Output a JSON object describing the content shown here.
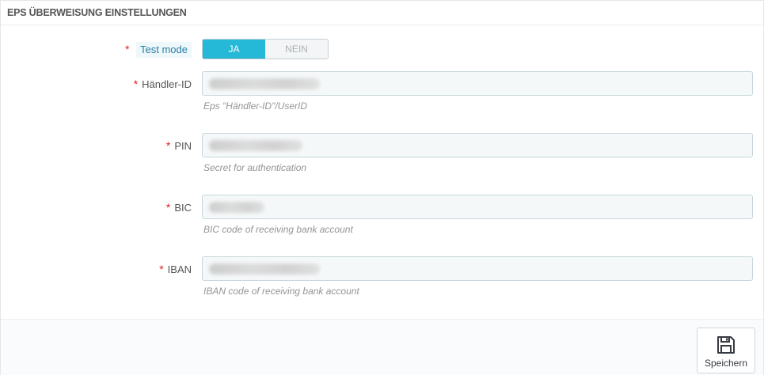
{
  "panel": {
    "title": "EPS ÜBERWEISUNG EINSTELLUNGEN"
  },
  "form": {
    "required_mark": "*",
    "test_mode": {
      "label": "Test mode",
      "options": [
        "JA",
        "NEIN"
      ],
      "selected": "JA"
    },
    "fields": [
      {
        "label": "Händler-ID",
        "help": "Eps \"Händler-ID\"/UserID"
      },
      {
        "label": "PIN",
        "help": "Secret for authentication"
      },
      {
        "label": "BIC",
        "help": "BIC code of receiving bank account"
      },
      {
        "label": "IBAN",
        "help": "IBAN code of receiving bank account"
      }
    ]
  },
  "footer": {
    "save_label": "Speichern",
    "save_icon": "floppy-disk-icon"
  },
  "colors": {
    "accent": "#25b9d7",
    "required": "#e02020",
    "tip_text": "#2a7fa6"
  }
}
